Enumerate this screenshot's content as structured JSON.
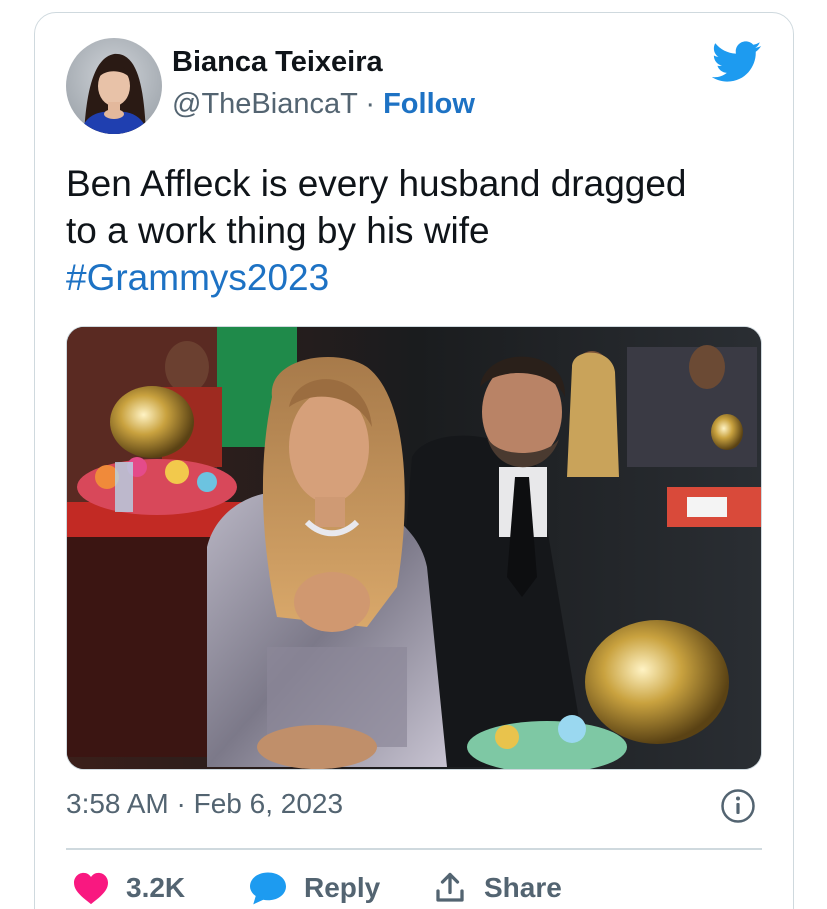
{
  "author": {
    "name": "Bianca Teixeira",
    "handle": "@TheBiancaT",
    "separator": "·",
    "follow_label": "Follow"
  },
  "tweet": {
    "lines": [
      "Ben Affleck is every husband dragged",
      "to a work thing by his wife"
    ],
    "hashtag": "#Grammys2023"
  },
  "meta": {
    "time": "3:58 AM",
    "separator": "·",
    "date": "Feb 6, 2023"
  },
  "actions": {
    "like_count": "3.2K",
    "reply_label": "Reply",
    "share_label": "Share"
  },
  "icons": {
    "brand": "twitter-bird-icon",
    "like": "heart-icon",
    "reply": "speech-bubble-icon",
    "share": "share-arrow-icon",
    "info": "info-icon"
  },
  "colors": {
    "brand_blue": "#1d9bf0",
    "link_blue": "#1d72c4",
    "like_red": "#f91880",
    "text_secondary": "#536471",
    "border": "#cfd9de"
  }
}
